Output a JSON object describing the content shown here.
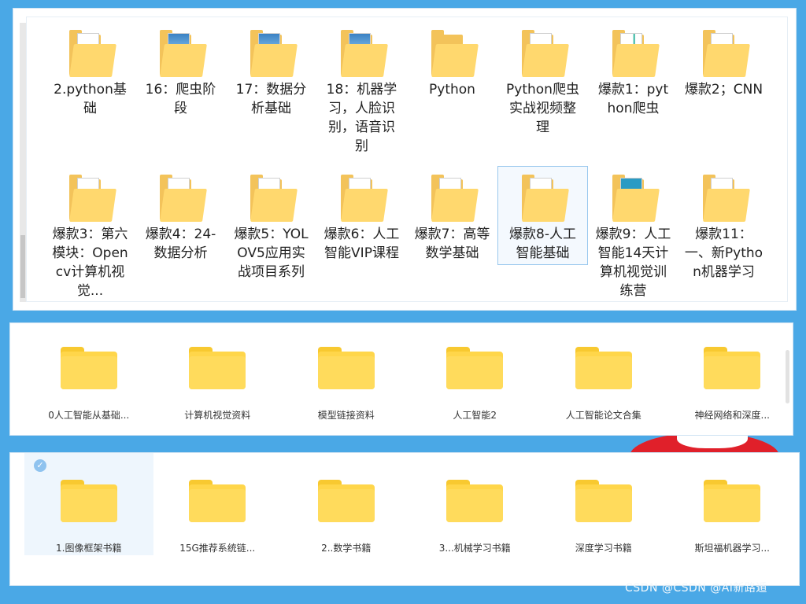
{
  "explorer": {
    "items": [
      {
        "label": "2.python基础",
        "paper": "plain"
      },
      {
        "label": "16：爬虫阶段",
        "paper": "pic"
      },
      {
        "label": "17：数据分析基础",
        "paper": "pic"
      },
      {
        "label": "18：机器学习，人脸识别，语音识别",
        "paper": "pic"
      },
      {
        "label": "Python",
        "paper": "none"
      },
      {
        "label": "Python爬虫实战视频整理",
        "paper": "plain"
      },
      {
        "label": "爆款1：python爬虫",
        "paper": "green"
      },
      {
        "label": "爆款2；CNN",
        "paper": "plain"
      },
      {
        "label": "爆款3：第六模块：Opencv计算机视觉...",
        "paper": "plain"
      },
      {
        "label": "爆款4：24-数据分析",
        "paper": "plain"
      },
      {
        "label": "爆款5：YOLOV5应用实战项目系列",
        "paper": "plain"
      },
      {
        "label": "爆款6：人工智能VIP课程",
        "paper": "plain"
      },
      {
        "label": "爆款7：高等数学基础",
        "paper": "plain"
      },
      {
        "label": "爆款8-人工智能基础",
        "paper": "plain"
      },
      {
        "label": "爆款9：人工智能14天计算机视觉训练营",
        "paper": "teal"
      },
      {
        "label": "爆款11：一、新Python机器学习",
        "paper": "plain"
      }
    ]
  },
  "cloud1": {
    "items": [
      {
        "label": "0人工智能从基础..."
      },
      {
        "label": "计算机视觉资料"
      },
      {
        "label": "模型链接资料"
      },
      {
        "label": "人工智能2"
      },
      {
        "label": "人工智能论文合集"
      },
      {
        "label": "神经网络和深度..."
      }
    ]
  },
  "cloud2": {
    "check_glyph": "✓",
    "items": [
      {
        "label": "1.图像框架书籍"
      },
      {
        "label": "15G推荐系统链..."
      },
      {
        "label": "2..数学书籍"
      },
      {
        "label": "3...机械学习书籍"
      },
      {
        "label": "深度学习书籍"
      },
      {
        "label": "斯坦福机器学习..."
      }
    ]
  },
  "watermark": "CSDN @CSDN @AI新路遁"
}
